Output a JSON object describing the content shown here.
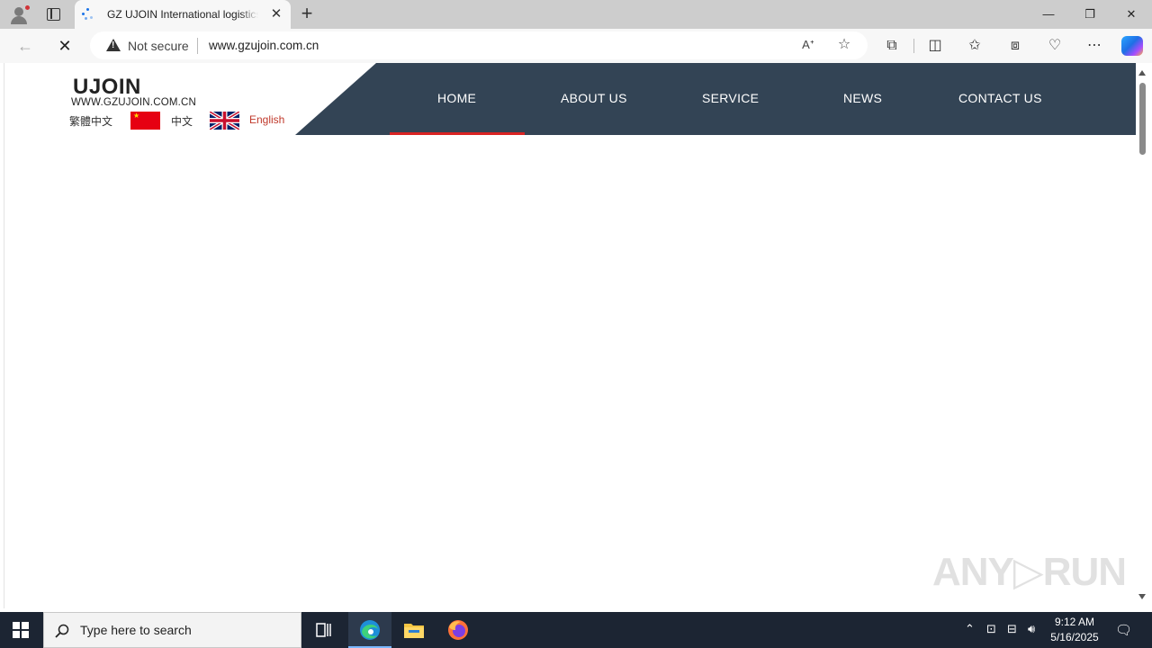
{
  "browser": {
    "tab_title": "GZ UJOIN International logistics Co.,Ltd",
    "tab_close": "✕",
    "new_tab": "+",
    "security_label": "Not secure",
    "url": "www.gzujoin.com.cn",
    "window_controls": {
      "minimize": "—",
      "restore": "❐",
      "close": "✕"
    }
  },
  "site": {
    "logo": "UJOIN",
    "logo_url": "WWW.GZUJOIN.COM.CN",
    "languages": [
      {
        "label": "繁體中文"
      },
      {
        "label": "中文"
      },
      {
        "label": "English"
      }
    ],
    "menu": [
      {
        "label": "HOME",
        "active": true
      },
      {
        "label": "ABOUT US"
      },
      {
        "label": "SERVICE"
      },
      {
        "label": "NEWS"
      },
      {
        "label": "CONTACT US"
      }
    ],
    "colors": {
      "nav_bg": "#334455",
      "active_bar": "#d92323",
      "english_link": "#c0392b"
    }
  },
  "taskbar": {
    "search_placeholder": "Type here to search",
    "time": "9:12 AM",
    "date": "5/16/2025"
  },
  "watermark": "ANY▷RUN"
}
